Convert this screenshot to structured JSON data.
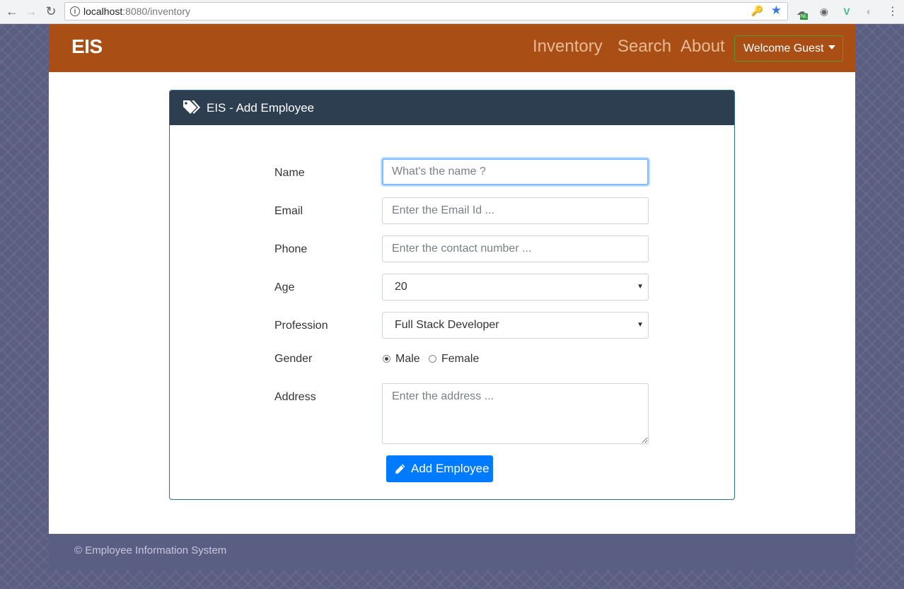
{
  "browser": {
    "url_host": "localhost",
    "url_path": ":8080/inventory",
    "info_glyph": "i",
    "ext_badge": "NL"
  },
  "navbar": {
    "brand": "EIS",
    "links": [
      "Inventory",
      "Search",
      "About"
    ],
    "welcome": "Welcome Guest"
  },
  "card": {
    "title": "EIS - Add Employee"
  },
  "form": {
    "name_label": "Name",
    "name_placeholder": "What's the name ?",
    "email_label": "Email",
    "email_placeholder": "Enter the Email Id ...",
    "phone_label": "Phone",
    "phone_placeholder": "Enter the contact number ...",
    "age_label": "Age",
    "age_value": "20",
    "profession_label": "Profession",
    "profession_value": "Full Stack Developer",
    "gender_label": "Gender",
    "gender_male": "Male",
    "gender_female": "Female",
    "gender_selected": "Male",
    "address_label": "Address",
    "address_placeholder": "Enter the address ...",
    "submit_label": "Add Employee"
  },
  "footer": {
    "text": "© Employee Information System"
  },
  "colors": {
    "navbar": "#a94f15",
    "card_header": "#2c3e50",
    "primary": "#007bff",
    "footer": "#5a5e82"
  }
}
